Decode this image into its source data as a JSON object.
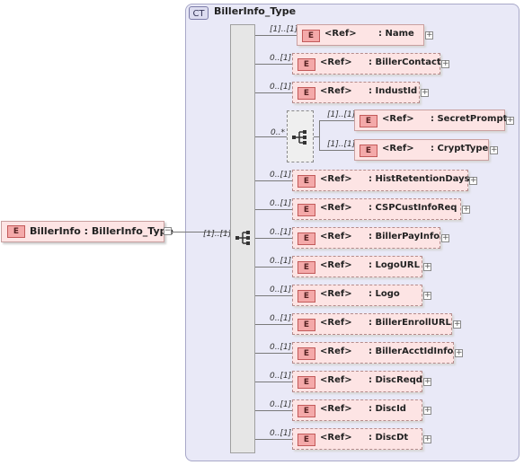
{
  "complex_type": {
    "tag": "CT",
    "name": "BillerInfo_Type"
  },
  "root": {
    "tag": "E",
    "label": "BillerInfo : BillerInfo_Type",
    "collapse": "−",
    "cardinality": "[1]..[1]"
  },
  "choice": {
    "cardinality": "0..*"
  },
  "elements": [
    {
      "tag": "E",
      "ref": "<Ref>",
      "name": ": Name",
      "cardinality": "[1]..[1]",
      "expand": "+"
    },
    {
      "tag": "E",
      "ref": "<Ref>",
      "name": ": BillerContact",
      "cardinality": "0..[1]",
      "expand": "+"
    },
    {
      "tag": "E",
      "ref": "<Ref>",
      "name": ": IndustId",
      "cardinality": "0..[1]",
      "expand": "+"
    },
    {
      "tag": "E",
      "ref": "<Ref>",
      "name": ": SecretPrompt",
      "cardinality": "[1]..[1]",
      "expand": "+"
    },
    {
      "tag": "E",
      "ref": "<Ref>",
      "name": ": CryptType",
      "cardinality": "[1]..[1]",
      "expand": "+"
    },
    {
      "tag": "E",
      "ref": "<Ref>",
      "name": ": HistRetentionDays",
      "cardinality": "0..[1]",
      "expand": "+"
    },
    {
      "tag": "E",
      "ref": "<Ref>",
      "name": ": CSPCustInfoReq",
      "cardinality": "0..[1]",
      "expand": "+"
    },
    {
      "tag": "E",
      "ref": "<Ref>",
      "name": ": BillerPayInfo",
      "cardinality": "0..[1]",
      "expand": "+"
    },
    {
      "tag": "E",
      "ref": "<Ref>",
      "name": ": LogoURL",
      "cardinality": "0..[1]",
      "expand": "+"
    },
    {
      "tag": "E",
      "ref": "<Ref>",
      "name": ": Logo",
      "cardinality": "0..[1]",
      "expand": "+"
    },
    {
      "tag": "E",
      "ref": "<Ref>",
      "name": ": BillerEnrollURL",
      "cardinality": "0..[1]",
      "expand": "+"
    },
    {
      "tag": "E",
      "ref": "<Ref>",
      "name": ": BillerAcctIdInfo",
      "cardinality": "0..[1]",
      "expand": "+"
    },
    {
      "tag": "E",
      "ref": "<Ref>",
      "name": ": DiscReqd",
      "cardinality": "0..[1]",
      "expand": "+"
    },
    {
      "tag": "E",
      "ref": "<Ref>",
      "name": ": DiscId",
      "cardinality": "0..[1]",
      "expand": "+"
    },
    {
      "tag": "E",
      "ref": "<Ref>",
      "name": ": DiscDt",
      "cardinality": "0..[1]",
      "expand": "+"
    }
  ]
}
